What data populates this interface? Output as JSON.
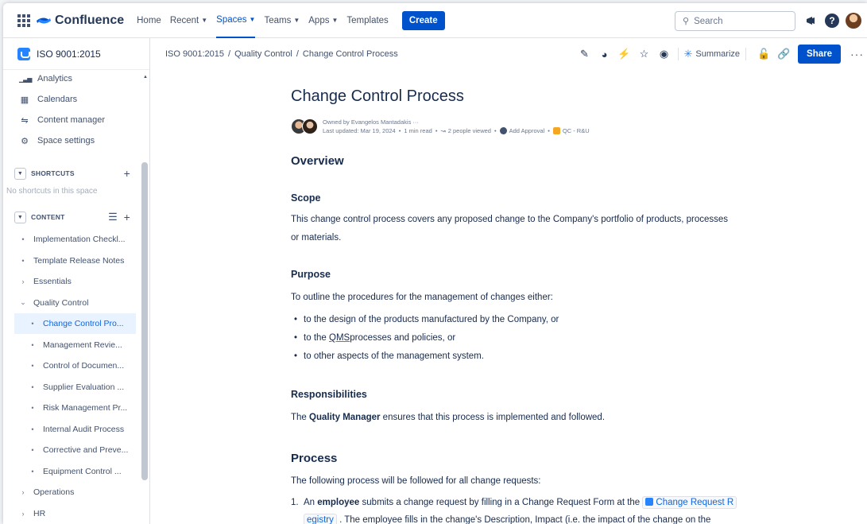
{
  "topnav": {
    "logo": "Confluence",
    "items": [
      {
        "label": "Home",
        "chevron": false
      },
      {
        "label": "Recent",
        "chevron": true
      },
      {
        "label": "Spaces",
        "chevron": true,
        "active": true
      },
      {
        "label": "Teams",
        "chevron": true
      },
      {
        "label": "Apps",
        "chevron": true
      },
      {
        "label": "Templates",
        "chevron": false
      }
    ],
    "create_label": "Create",
    "search_placeholder": "Search",
    "help_glyph": "?"
  },
  "sidebar": {
    "space_name": "ISO 9001:2015",
    "items": [
      {
        "icon": "analytics-icon",
        "glyph": "▁▃▅",
        "label": "Analytics"
      },
      {
        "icon": "calendar-icon",
        "glyph": "▦",
        "label": "Calendars"
      },
      {
        "icon": "content-manager-icon",
        "glyph": "⇋",
        "label": "Content manager"
      },
      {
        "icon": "gear-icon",
        "glyph": "⚙",
        "label": "Space settings"
      }
    ],
    "shortcuts_header": "SHORTCUTS",
    "shortcuts_empty": "No shortcuts in this space",
    "content_header": "CONTENT",
    "tree": [
      {
        "label": "Implementation Checkl...",
        "bullet": "•",
        "level": 0
      },
      {
        "label": "Template Release Notes",
        "bullet": "•",
        "level": 0
      },
      {
        "label": "Essentials",
        "bullet": "›",
        "level": 0
      },
      {
        "label": "Quality Control",
        "bullet": "⌄",
        "level": 0
      },
      {
        "label": "Change Control Pro...",
        "bullet": "•",
        "level": 1,
        "selected": true
      },
      {
        "label": "Management Revie...",
        "bullet": "•",
        "level": 1
      },
      {
        "label": "Control of Documen...",
        "bullet": "•",
        "level": 1
      },
      {
        "label": "Supplier Evaluation ...",
        "bullet": "•",
        "level": 1
      },
      {
        "label": "Risk Management Pr...",
        "bullet": "•",
        "level": 1
      },
      {
        "label": "Internal Audit Process",
        "bullet": "•",
        "level": 1
      },
      {
        "label": "Corrective and Preve...",
        "bullet": "•",
        "level": 1
      },
      {
        "label": "Equipment Control ...",
        "bullet": "•",
        "level": 1
      },
      {
        "label": "Operations",
        "bullet": "›",
        "level": 0
      },
      {
        "label": "HR",
        "bullet": "›",
        "level": 0
      }
    ]
  },
  "breadcrumb": [
    "ISO 9001:2015",
    "Quality Control",
    "Change Control Process"
  ],
  "toolbar": {
    "summarize_label": "Summarize",
    "share_label": "Share",
    "more_label": "···"
  },
  "page": {
    "title": "Change Control Process",
    "owner_line": "Owned by Evangelos Mantadakis ···",
    "last_updated": "Last updated: Mar 19, 2024",
    "read_time": "1 min read",
    "viewed": "2 people viewed",
    "approval": "Add Approval",
    "label": "QC - R&U",
    "overview_heading": "Overview",
    "scope_heading": "Scope",
    "scope_text_1": "This change control process covers any proposed change to the Company's portfolio of products, processes",
    "scope_text_2": "or materials.",
    "purpose_heading": "Purpose",
    "purpose_intro": "To outline the procedures for the management of changes either:",
    "purpose_bullets": {
      "b1": "to the design of the products manufactured by the Company, or",
      "b2_pre": "to the ",
      "b2_qms": "QMS",
      "b2_post": " processes and policies, or",
      "b3": "to other aspects of the management system."
    },
    "resp_heading": "Responsibilities",
    "resp_pre": "The ",
    "resp_bold": "Quality Manager",
    "resp_post": " ensures that this process is implemented and followed.",
    "process_heading": "Process",
    "process_intro": "The following process will be followed for all change requests:",
    "step1": {
      "num": "1.",
      "pre": "An ",
      "bold": "employee",
      "mid": " submits a change request by filling in a Change Request Form at the ",
      "link_1": "Change Request R",
      "link_2": "egistry",
      "post": " . The employee fills in the change's Description, Impact (i.e. the impact of the change on the"
    }
  }
}
